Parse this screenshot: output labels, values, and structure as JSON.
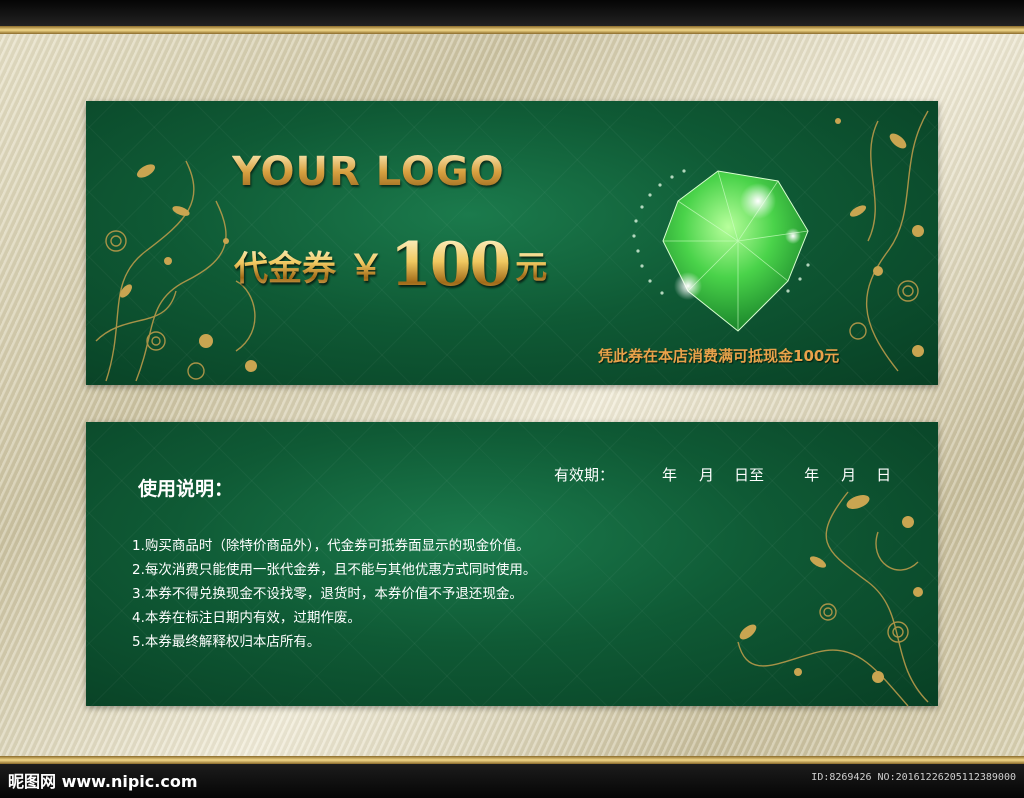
{
  "front": {
    "logo_text": "YOUR LOGO",
    "voucher_label": "代金券",
    "currency_symbol": "￥",
    "amount": "100",
    "unit": "元",
    "note": "凭此券在本店消费满可抵现金100元"
  },
  "back": {
    "usage_title": "使用说明：",
    "validity": {
      "label": "有效期：",
      "year1": "年",
      "month1": "月",
      "day_to": "日至",
      "year2": "年",
      "month2": "月",
      "day2": "日"
    },
    "rules": [
      "1.购买商品时（除特价商品外），代金券可抵券面显示的现金价值。",
      "2.每次消费只能使用一张代金券，且不能与其他优惠方式同时使用。",
      "3.本券不得兑换现金不设找零，退货时，本券价值不予退还现金。",
      "4.本券在标注日期内有效，过期作废。",
      "5.本券最终解释权归本店所有。"
    ]
  },
  "footer": {
    "watermark": "昵图网 www.nipic.com",
    "image_id": "ID:8269426 NO:20161226205112389000"
  },
  "colors": {
    "card_green": "#0f5a35",
    "gold": "#d8a040",
    "note_orange": "#e8a24a"
  },
  "icons": [
    "emerald-gem-icon",
    "gold-floral-ornament-icon"
  ]
}
